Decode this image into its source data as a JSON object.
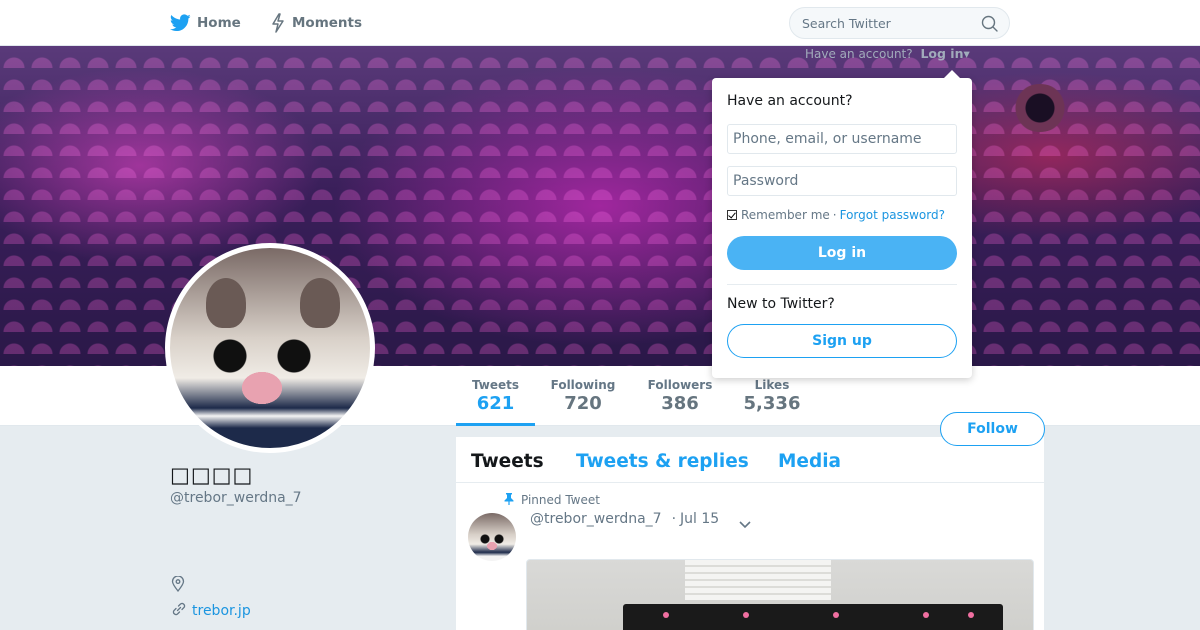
{
  "colors": {
    "accent": "#1da1f2",
    "link": "#1b95e0",
    "muted_text": "#657786",
    "page_background": "#e6ecf0",
    "login_button": "#4ab3f4"
  },
  "nav": {
    "home_label": "Home",
    "moments_label": "Moments",
    "home_icon": "twitter-bird-icon",
    "moments_icon": "lightning-icon",
    "search": {
      "placeholder": "Search Twitter",
      "value": "",
      "icon": "search-icon"
    }
  },
  "login_hint": {
    "prompt": "Have an account?",
    "link_label": "Log in",
    "caret": "▾"
  },
  "login_dropdown": {
    "heading": "Have an account?",
    "username_placeholder": "Phone, email, or username",
    "username_value": "",
    "password_placeholder": "Password",
    "password_value": "",
    "remember_label": "Remember me",
    "remember_checked": true,
    "separator": "·",
    "forgot_label": "Forgot password?",
    "login_button": "Log in",
    "new_prompt": "New to Twitter?",
    "signup_button": "Sign up"
  },
  "profile": {
    "name": "□□□□",
    "handle": "@trebor_werdna_7",
    "location_icon": "map-pin-icon",
    "url_icon": "link-icon",
    "url": "trebor.jp",
    "follow_button": "Follow"
  },
  "stats": [
    {
      "label": "Tweets",
      "value": "621",
      "active": true
    },
    {
      "label": "Following",
      "value": "720",
      "active": false
    },
    {
      "label": "Followers",
      "value": "386",
      "active": false
    },
    {
      "label": "Likes",
      "value": "5,336",
      "active": false
    }
  ],
  "timeline": {
    "tabs": [
      {
        "label": "Tweets",
        "active": true
      },
      {
        "label": "Tweets & replies",
        "active": false
      },
      {
        "label": "Media",
        "active": false
      }
    ],
    "pinned": {
      "label": "Pinned Tweet",
      "icon": "pin-icon",
      "handle": "@trebor_werdna_7",
      "separator": "·",
      "date": "Jul 15",
      "menu_icon": "chevron-down-icon"
    }
  }
}
